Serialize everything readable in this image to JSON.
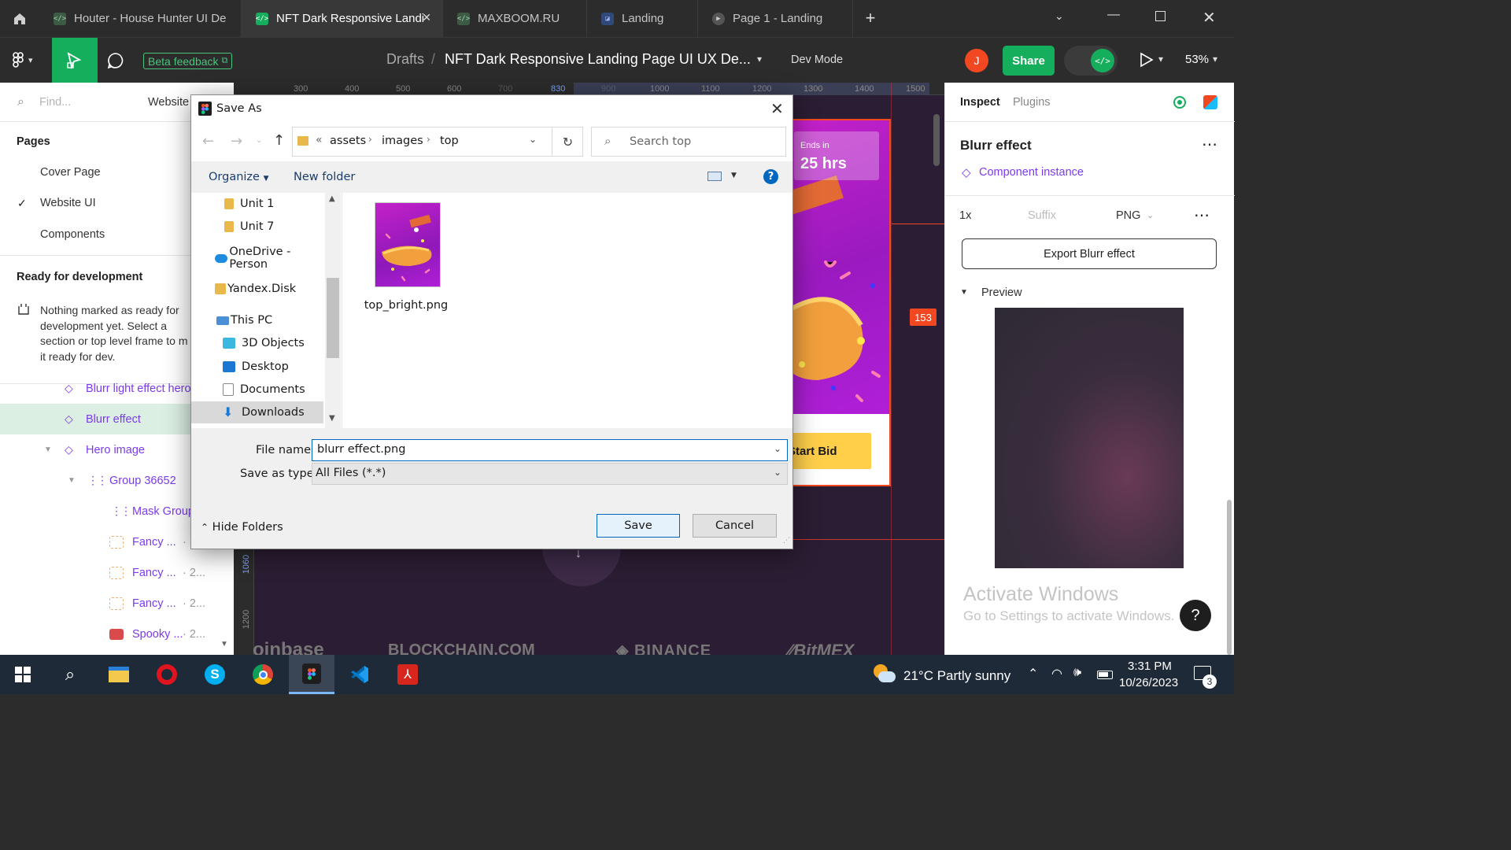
{
  "tabs": [
    {
      "label": "Houter - House Hunter UI De",
      "icon": "figma-dev-icon"
    },
    {
      "label": "NFT Dark Responsive Landi",
      "icon": "figma-dev-icon",
      "active": true
    },
    {
      "label": "MAXBOOM.RU",
      "icon": "figma-dev-icon"
    },
    {
      "label": "Landing",
      "icon": "figma-file-icon"
    },
    {
      "label": "Page 1 - Landing",
      "icon": "prototype-icon"
    }
  ],
  "toolbar": {
    "beta_feedback": "Beta feedback",
    "breadcrumb_root": "Drafts",
    "breadcrumb_sep": "/",
    "file_title": "NFT Dark Responsive Landing Page UI UX De...",
    "dev_mode": "Dev Mode",
    "avatar_initial": "J",
    "share": "Share",
    "zoom": "53%"
  },
  "left": {
    "search_placeholder": "Find...",
    "page_selector": "Website",
    "pages_heading": "Pages",
    "pages": [
      "Cover Page",
      "Website UI",
      "Components"
    ],
    "ready_heading": "Ready for development",
    "ready_text": [
      "Nothing marked as ready for",
      "development yet. Select a",
      "section or top level frame to m",
      "it ready for dev."
    ],
    "layers": [
      {
        "label": "Blurr light effect hero",
        "meta": ""
      },
      {
        "label": "Blurr effect",
        "meta": ""
      },
      {
        "label": "Hero image",
        "meta": ""
      },
      {
        "label": "Group 36652",
        "meta": ""
      },
      {
        "label": "Mask Group",
        "meta": ""
      },
      {
        "label": "Fancy ...",
        "meta": "·"
      },
      {
        "label": "Fancy ...",
        "meta": "· 2..."
      },
      {
        "label": "Fancy ...",
        "meta": "· 2..."
      },
      {
        "label": "Spooky ...",
        "meta": "· 2..."
      }
    ]
  },
  "canvas": {
    "ruler_ticks": [
      "300",
      "400",
      "500",
      "600",
      "700",
      "830",
      "900",
      "1000",
      "1100",
      "1200",
      "1300",
      "1400",
      "1500"
    ],
    "ruler_left": [
      "1060",
      "1200"
    ],
    "ends_label": "Ends in",
    "ends_value": "25 hrs",
    "bid_button": "Start Bid",
    "measure_badge": "153",
    "logos": [
      "oinbase",
      "BLOCKCHAIN.COM",
      "BINANCE",
      "BitMEX"
    ]
  },
  "right": {
    "tabs": [
      "Inspect",
      "Plugins"
    ],
    "title": "Blurr effect",
    "component_link": "Component instance",
    "export_scale": "1x",
    "export_suffix_placeholder": "Suffix",
    "export_format": "PNG",
    "export_button": "Export Blurr effect",
    "preview_label": "Preview",
    "activate_title": "Activate Windows",
    "activate_sub": "Go to Settings to activate Windows.",
    "help": "?"
  },
  "dialog": {
    "title": "Save As",
    "path": [
      "«",
      "assets",
      "images",
      "top"
    ],
    "search_placeholder": "Search top",
    "organize": "Organize",
    "new_folder": "New folder",
    "help": "?",
    "nav": [
      {
        "label": "Unit 1",
        "icon": "folder-icon"
      },
      {
        "label": "Unit 7",
        "icon": "folder-icon"
      },
      {
        "label": "OneDrive - Person",
        "icon": "onedrive-icon"
      },
      {
        "label": "Yandex.Disk",
        "icon": "folder-icon"
      },
      {
        "label": "This PC",
        "icon": "this-pc-icon"
      },
      {
        "label": "3D Objects",
        "icon": "3d-objects-icon"
      },
      {
        "label": "Desktop",
        "icon": "desktop-icon"
      },
      {
        "label": "Documents",
        "icon": "documents-icon"
      },
      {
        "label": "Downloads",
        "icon": "downloads-icon"
      }
    ],
    "file_name": "top_bright.png",
    "file_name_label": "File name:",
    "file_name_value": "blurr effect.png",
    "save_type_label": "Save as type:",
    "save_type_value": "All Files (*.*)",
    "hide_folders": "Hide Folders",
    "save": "Save",
    "cancel": "Cancel"
  },
  "taskbar": {
    "weather": "21°C  Partly sunny",
    "time": "3:31 PM",
    "date": "10/26/2023",
    "notif_count": "3"
  },
  "colors": {
    "figma_green": "#14ae5c",
    "accent_purple": "#7c3aed",
    "win_blue": "#0067c0",
    "avatar_red": "#f24822"
  }
}
